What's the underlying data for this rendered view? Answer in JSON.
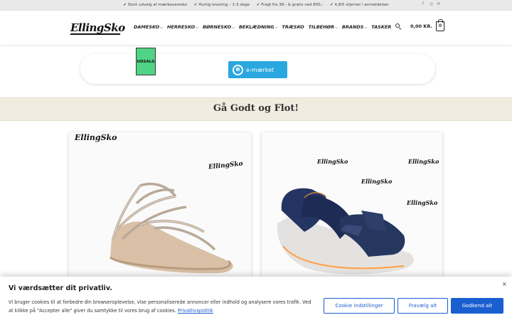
{
  "topbar": {
    "usps": [
      "✔ Stort udvalg af mærkevaresko",
      "✔ Hurtig levering – 1-3 dage",
      "✔ Fragt fra 38,- & gratis ved 800,-",
      "✔ 4,8/5 stjerner i anmeldelser"
    ],
    "social_icons": [
      "facebook-icon",
      "instagram-icon",
      "email-icon"
    ]
  },
  "header": {
    "logo_text": "EllingSko",
    "nav": [
      {
        "label": "DAMESKO",
        "has_dropdown": true
      },
      {
        "label": "HERRESKO",
        "has_dropdown": true
      },
      {
        "label": "BØRNESKO",
        "has_dropdown": true
      },
      {
        "label": "BEKLÆDNING",
        "has_dropdown": true
      },
      {
        "label": "TRÆSKO",
        "has_dropdown": false
      },
      {
        "label": "TILBEHØR",
        "has_dropdown": true
      },
      {
        "label": "BRANDS",
        "has_dropdown": true
      },
      {
        "label": "TASKER",
        "has_dropdown": false
      }
    ],
    "cart_total": "0,00 KR.",
    "cart_count": "0"
  },
  "badges": {
    "udsalg": "UDSALG",
    "emaerket": "e-mærket",
    "emaerket_letter": "e"
  },
  "banner": {
    "title": "Gå Godt og Flot!"
  },
  "products": {
    "card1_watermark": "EllingSko",
    "card2_watermarks": [
      "EllingSko",
      "EllingSko",
      "EllingSko",
      "EllingSko",
      "EllingSko"
    ]
  },
  "cookie": {
    "title": "Vi værdsætter dit privatliv.",
    "text": "Vi bruger cookies til at forbedre din browseroplevelse, vise personaliserede annoncer eller indhold og analysere vores trafik. Ved at klikke på \"Accepter alle\" giver du samtykke til vores brug af cookies.",
    "policy_link": "Privatlivspolitik",
    "close": "×",
    "buttons": {
      "customize": "Cookie indstillinger",
      "reject": "Fravælg alt",
      "accept": "Godkend alt"
    }
  },
  "colors": {
    "accent_blue": "#1a5fd0",
    "udsalg_green": "#4fd485",
    "emaerket_blue": "#2aa7df",
    "banner_beige": "#f2ece0"
  }
}
